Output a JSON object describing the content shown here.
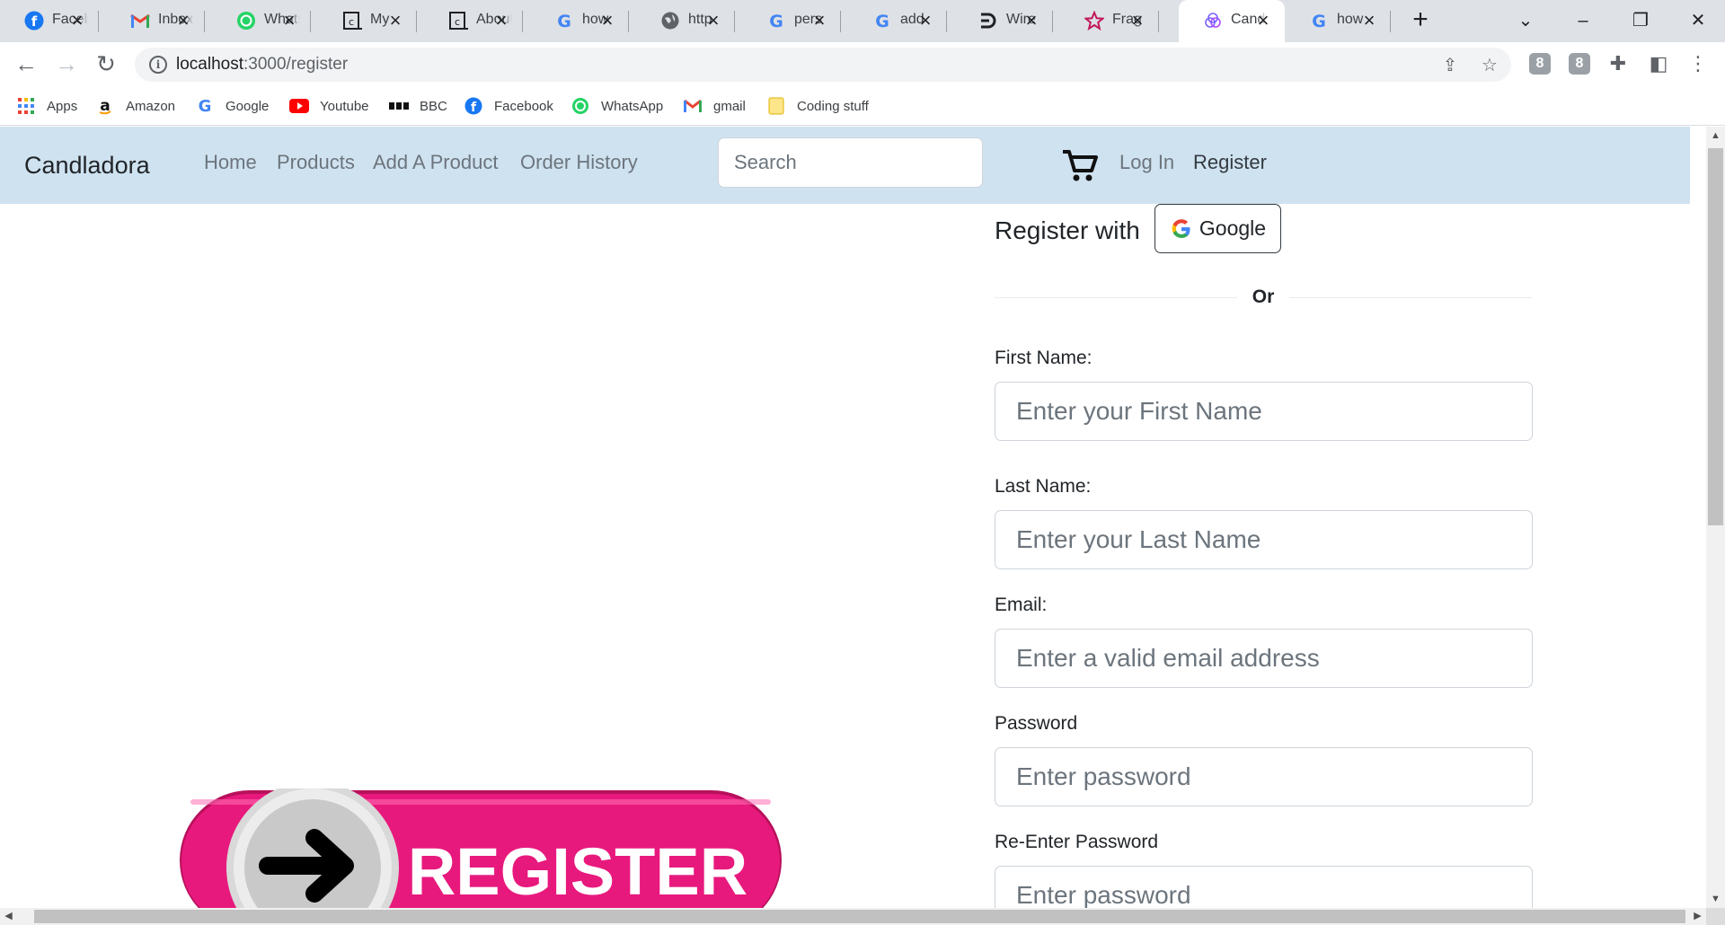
{
  "browser": {
    "tabs": [
      {
        "title": "Facebook",
        "icon": "facebook-icon",
        "color": "#1877f2",
        "active": false
      },
      {
        "title": "Inbox",
        "icon": "gmail-icon",
        "color": "#ea4335",
        "active": false
      },
      {
        "title": "WhatsApp",
        "icon": "whatsapp-icon",
        "color": "#25d366",
        "active": false
      },
      {
        "title": "My ",
        "icon": "codecademy-icon",
        "color": "#202124",
        "active": false
      },
      {
        "title": "About",
        "icon": "codecademy-icon",
        "color": "#202124",
        "active": false
      },
      {
        "title": "how",
        "icon": "google-icon",
        "color": "#4285f4",
        "active": false
      },
      {
        "title": "http",
        "icon": "globe-icon",
        "color": "#5f6368",
        "active": false
      },
      {
        "title": "pers",
        "icon": "google-icon",
        "color": "#4285f4",
        "active": false
      },
      {
        "title": "add",
        "icon": "google-icon",
        "color": "#4285f4",
        "active": false
      },
      {
        "title": "Wire",
        "icon": "wireframe-icon",
        "color": "#202124",
        "active": false
      },
      {
        "title": "Frag",
        "icon": "star-icon",
        "color": "#c2185b",
        "active": false
      },
      {
        "title": "Cand",
        "icon": "candle-icon",
        "color": "#7b61ff",
        "active": true
      },
      {
        "title": "how",
        "icon": "google-icon",
        "color": "#4285f4",
        "active": false
      }
    ],
    "url_host": "localhost",
    "url_path": ":3000/register",
    "bookmarks": [
      {
        "label": "Apps",
        "icon": "apps-grid-icon"
      },
      {
        "label": "Amazon",
        "icon": "amazon-icon"
      },
      {
        "label": "Google",
        "icon": "google-icon"
      },
      {
        "label": "Youtube",
        "icon": "youtube-icon"
      },
      {
        "label": "BBC",
        "icon": "bbc-icon"
      },
      {
        "label": "Facebook",
        "icon": "facebook-icon"
      },
      {
        "label": "WhatsApp",
        "icon": "whatsapp-icon"
      },
      {
        "label": "gmail",
        "icon": "gmail-icon"
      },
      {
        "label": "Coding stuff",
        "icon": "folder-icon"
      }
    ],
    "extension_badges": [
      "8",
      "8"
    ]
  },
  "site": {
    "brand": "Candladora",
    "nav": [
      "Home",
      "Products",
      "Add A Product",
      "Order History"
    ],
    "search_placeholder": "Search",
    "login": "Log In",
    "register": "Register"
  },
  "register": {
    "with_label": "Register with",
    "google_label": "Google",
    "or_label": "Or",
    "fields": [
      {
        "label": "First Name:",
        "placeholder": "Enter your First Name"
      },
      {
        "label": "Last Name:",
        "placeholder": "Enter your Last Name"
      },
      {
        "label": "Email:",
        "placeholder": "Enter a valid email address"
      },
      {
        "label": "Password",
        "placeholder": "Enter password"
      },
      {
        "label": "Re-Enter Password",
        "placeholder": "Enter password"
      }
    ],
    "banner_text": "REGISTER"
  },
  "colors": {
    "navbar_bg": "#cfe2f0",
    "banner_pink": "#e8197d",
    "active_tab_bg": "#ffffff",
    "tabstrip_bg": "#dee1e6"
  }
}
